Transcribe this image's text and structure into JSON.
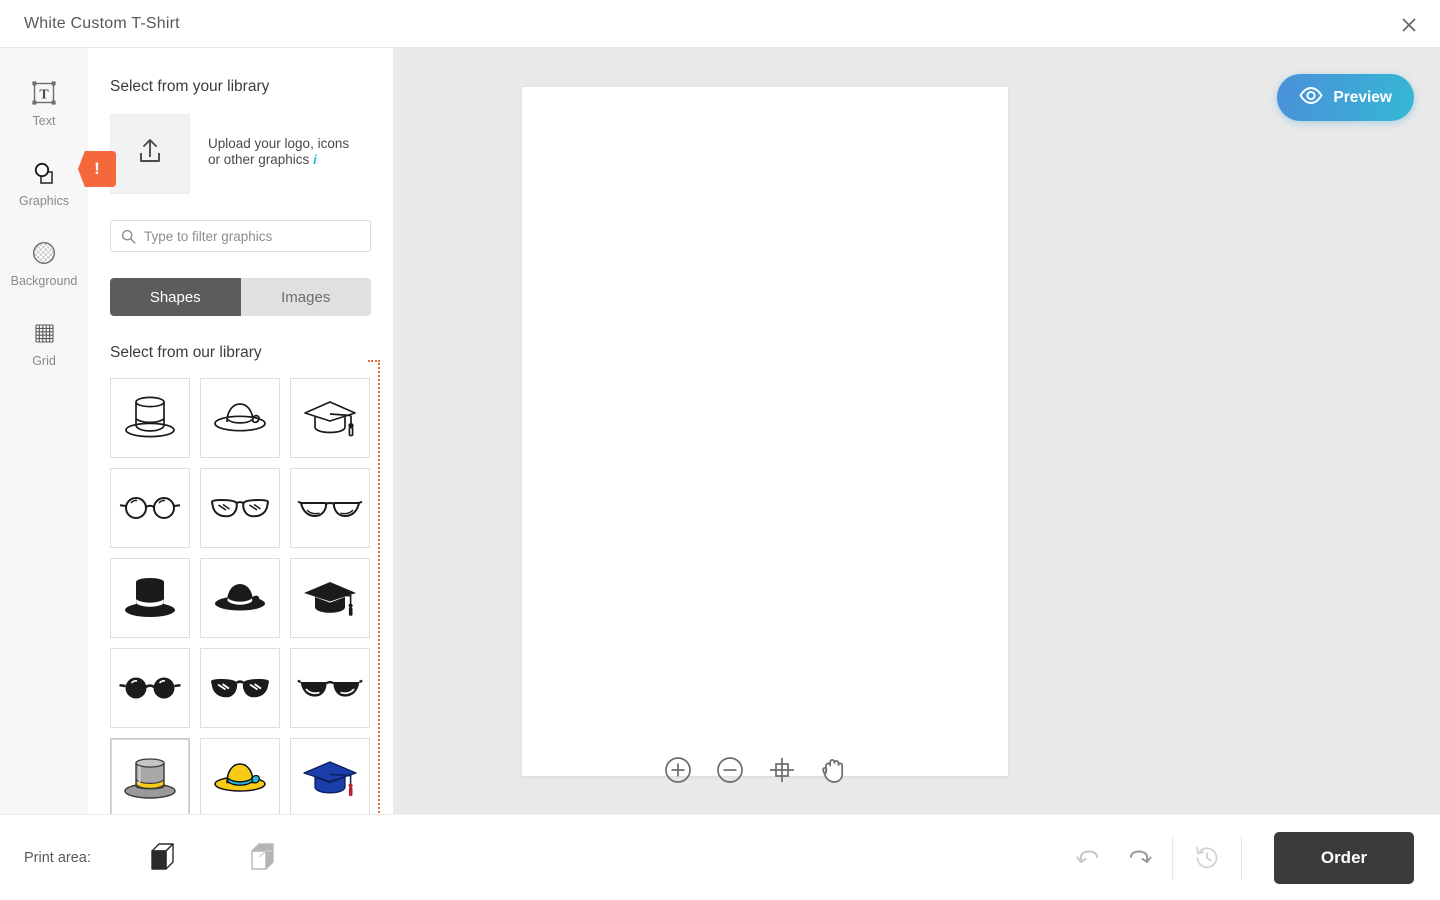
{
  "window": {
    "title": "White Custom T-Shirt",
    "close_icon": "close-icon"
  },
  "sidebar": {
    "items": [
      {
        "label": "Text",
        "icon": "text-icon"
      },
      {
        "label": "Graphics",
        "icon": "graphics-icon"
      },
      {
        "label": "Background",
        "icon": "background-icon"
      },
      {
        "label": "Grid",
        "icon": "grid-icon"
      }
    ]
  },
  "panel": {
    "your_library_heading": "Select from your library",
    "upload": {
      "icon": "upload-icon",
      "text_line1": "Upload your logo, icons",
      "text_line2": "or other graphics",
      "info_icon": "info-icon",
      "info_glyph": "i"
    },
    "search": {
      "icon": "search-icon",
      "placeholder": "Type to filter graphics",
      "value": ""
    },
    "tabs": [
      {
        "label": "Shapes",
        "active": true
      },
      {
        "label": "Images",
        "active": false
      }
    ],
    "our_library_heading": "Select from our library",
    "graphics": [
      {
        "name": "top-hat-outline",
        "style": "outline",
        "subject": "top-hat"
      },
      {
        "name": "sun-hat-outline",
        "style": "outline",
        "subject": "sun-hat"
      },
      {
        "name": "graduation-cap-outline",
        "style": "outline",
        "subject": "graduation-cap"
      },
      {
        "name": "round-glasses-outline",
        "style": "outline",
        "subject": "round-glasses"
      },
      {
        "name": "wayfarer-glasses-outline",
        "style": "outline",
        "subject": "wayfarer-glasses"
      },
      {
        "name": "aviator-glasses-outline",
        "style": "outline",
        "subject": "aviator-glasses"
      },
      {
        "name": "top-hat-solid",
        "style": "solid",
        "subject": "top-hat"
      },
      {
        "name": "sun-hat-solid",
        "style": "solid",
        "subject": "sun-hat"
      },
      {
        "name": "graduation-cap-solid",
        "style": "solid",
        "subject": "graduation-cap"
      },
      {
        "name": "round-glasses-solid",
        "style": "solid",
        "subject": "round-glasses"
      },
      {
        "name": "wayfarer-glasses-solid",
        "style": "solid",
        "subject": "wayfarer-glasses"
      },
      {
        "name": "aviator-glasses-solid",
        "style": "solid",
        "subject": "aviator-glasses"
      },
      {
        "name": "top-hat-color",
        "style": "color",
        "subject": "top-hat",
        "selected": true
      },
      {
        "name": "sun-hat-color",
        "style": "color",
        "subject": "sun-hat"
      },
      {
        "name": "graduation-cap-color",
        "style": "color",
        "subject": "graduation-cap"
      }
    ]
  },
  "badges": [
    {
      "glyph": "!",
      "name": "graphics-alert-badge"
    },
    {
      "glyph": "!",
      "name": "library-alert-badge"
    }
  ],
  "canvas": {
    "preview_button": "Preview",
    "preview_icon": "eye-icon",
    "tools": [
      {
        "name": "zoom-in-icon",
        "glyph": "+"
      },
      {
        "name": "zoom-out-icon",
        "glyph": "-"
      },
      {
        "name": "center-view-icon",
        "glyph": "crosshair"
      },
      {
        "name": "pan-hand-icon",
        "glyph": "hand"
      }
    ]
  },
  "bottombar": {
    "print_area_label": "Print area:",
    "print_areas": [
      {
        "name": "print-area-front",
        "active": true
      },
      {
        "name": "print-area-back",
        "active": false
      }
    ],
    "undo_icon": "undo-icon",
    "redo_icon": "redo-icon",
    "history_icon": "history-icon",
    "order_label": "Order"
  },
  "colors": {
    "accent_orange": "#f4683c",
    "order_dark": "#3b3b3b",
    "preview_blue_start": "#4a90d9",
    "preview_blue_end": "#35b7d4",
    "info_cyan": "#29b6d8",
    "tab_active": "#5c5c5c",
    "rail_bg": "#f7f7f7",
    "canvas_bg": "#e9e9e9"
  }
}
